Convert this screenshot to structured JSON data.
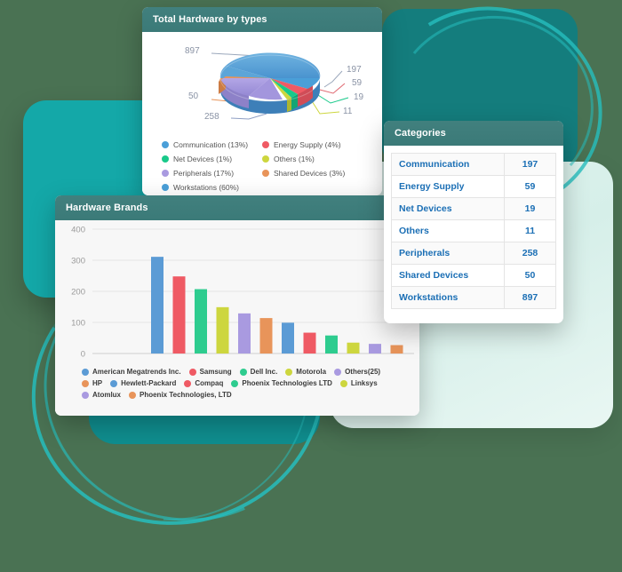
{
  "background": {
    "page_color": "#4a7253",
    "accent_teal": "#14A8A8",
    "mint": "#dff3ee"
  },
  "pie_card": {
    "title": "Total Hardware by types",
    "callouts": [
      "897",
      "197",
      "59",
      "19",
      "11",
      "258",
      "50"
    ],
    "legend": [
      {
        "label": "Communication (13%)",
        "color": "#4a9fd8"
      },
      {
        "label": "Energy Supply (4%)",
        "color": "#ef5a64"
      },
      {
        "label": "Net Devices (1%)",
        "color": "#19c98a"
      },
      {
        "label": "Others (1%)",
        "color": "#cdd63e"
      },
      {
        "label": "Peripherals (17%)",
        "color": "#a99ae0"
      },
      {
        "label": "Shared Devices (3%)",
        "color": "#e8945a"
      },
      {
        "label": "Workstations (60%)",
        "color": "#4a9fd8"
      }
    ]
  },
  "bar_card": {
    "title": "Hardware Brands"
  },
  "categories_card": {
    "title": "Categories",
    "rows": [
      {
        "name": "Communication",
        "value": "197"
      },
      {
        "name": "Energy Supply",
        "value": "59"
      },
      {
        "name": "Net Devices",
        "value": "19"
      },
      {
        "name": "Others",
        "value": "11"
      },
      {
        "name": "Peripherals",
        "value": "258"
      },
      {
        "name": "Shared Devices",
        "value": "50"
      },
      {
        "name": "Workstations",
        "value": "897"
      }
    ]
  },
  "chart_data": [
    {
      "type": "pie",
      "title": "Total Hardware by types",
      "labels": [
        "Communication",
        "Energy Supply",
        "Net Devices",
        "Others",
        "Peripherals",
        "Shared Devices",
        "Workstations"
      ],
      "values": [
        197,
        59,
        19,
        11,
        258,
        50,
        897
      ],
      "percents": [
        13,
        4,
        1,
        1,
        17,
        3,
        60
      ],
      "colors": [
        "#4a9fd8",
        "#ef5a64",
        "#19c98a",
        "#cdd63e",
        "#a99ae0",
        "#e8945a",
        "#4a9fd8"
      ],
      "legend_position": "bottom",
      "three_d": true
    },
    {
      "type": "bar",
      "title": "Hardware Brands",
      "xlabel": "",
      "ylabel": "",
      "ylim": [
        0,
        400
      ],
      "yticks": [
        0,
        100,
        200,
        300,
        400
      ],
      "grid": true,
      "legend_position": "bottom",
      "categories": [
        "American Megatrends Inc.",
        "Samsung",
        "Dell Inc.",
        "Motorola",
        "Others(25)",
        "HP",
        "Hewlett-Packard",
        "Compaq",
        "Phoenix Technologies LTD",
        "Linksys",
        "Atomlux",
        "Phoenix Technologies, LTD"
      ],
      "values": [
        311,
        248,
        207,
        149,
        129,
        114,
        99,
        67,
        58,
        35,
        31,
        27
      ],
      "colors": [
        "#5b9bd5",
        "#ef5a64",
        "#2ecc8f",
        "#cdd63e",
        "#a99ae0",
        "#e8945a",
        "#5b9bd5",
        "#ef5a64",
        "#2ecc8f",
        "#cdd63e",
        "#a99ae0",
        "#e8945a"
      ]
    }
  ]
}
